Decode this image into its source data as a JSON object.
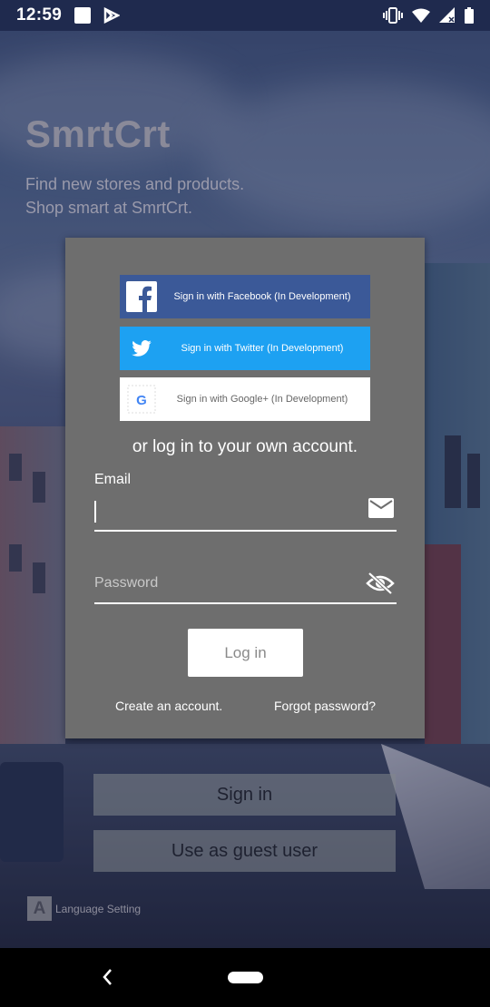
{
  "status_bar": {
    "time": "12:59",
    "icons": [
      "notification-square-icon",
      "play-store-icon",
      "vibrate-icon",
      "wifi-icon",
      "signal-icon",
      "battery-icon"
    ]
  },
  "app": {
    "name": "SmrtCrt",
    "tagline_line1": "Find new stores and products.",
    "tagline_line2": "Shop smart at SmrtCrt."
  },
  "dialog": {
    "facebook_label": "Sign in with Facebook (In Development)",
    "twitter_label": "Sign in with Twitter (In Development)",
    "google_label": "Sign in with Google+ (In Development)",
    "or_text": "or log in to your own account.",
    "email_label": "Email",
    "email_value": "",
    "password_placeholder": "Password",
    "login_label": "Log in",
    "create_account": "Create an account.",
    "forgot_password": "Forgot password?"
  },
  "main": {
    "sign_in_label": "Sign in",
    "guest_label": "Use as guest user",
    "language_label": "Language Setting",
    "language_icon_letter": "A"
  },
  "colors": {
    "facebook": "#3b5998",
    "twitter": "#1da1f2",
    "dialog_bg": "#6e6e6e",
    "status_bar": "#1f2a4e"
  }
}
